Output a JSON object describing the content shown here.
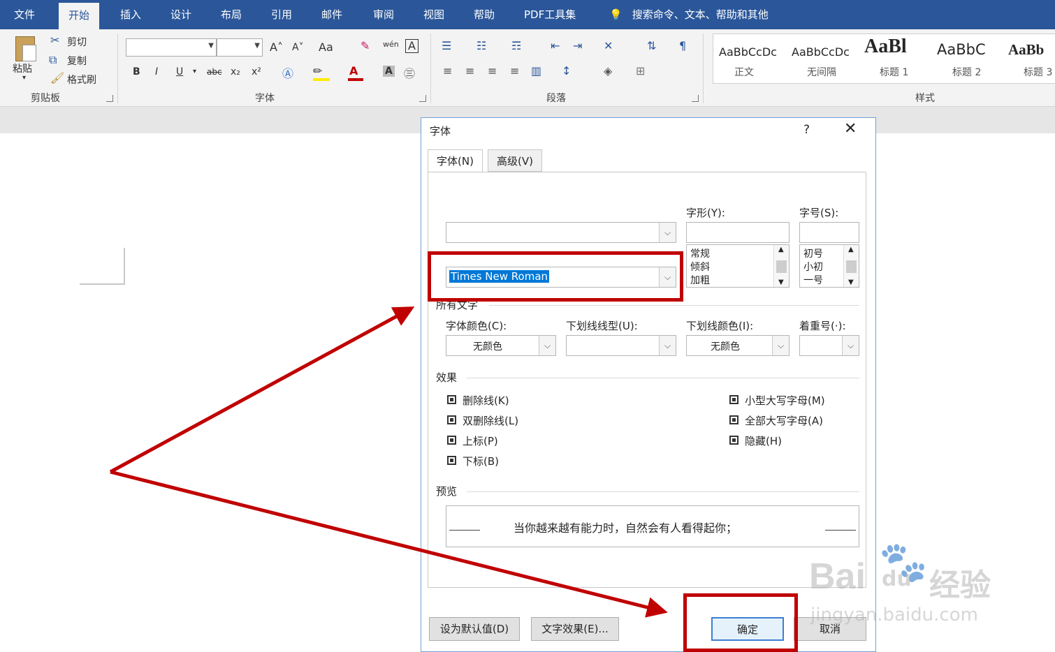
{
  "ribbon": {
    "tabs": [
      {
        "label": "文件",
        "x": 0
      },
      {
        "label": "开始",
        "x": 0
      },
      {
        "label": "插入",
        "x": 0
      },
      {
        "label": "设计",
        "x": 0
      },
      {
        "label": "布局",
        "x": 0
      },
      {
        "label": "引用",
        "x": 0
      },
      {
        "label": "邮件",
        "x": 0
      },
      {
        "label": "审阅",
        "x": 0
      },
      {
        "label": "视图",
        "x": 0
      },
      {
        "label": "帮助",
        "x": 0
      },
      {
        "label": "PDF工具集",
        "x": 0
      }
    ],
    "search_placeholder": "搜索命令、文本、帮助和其他",
    "clipboard": {
      "paste": "粘贴",
      "cut": "剪切",
      "copy": "复制",
      "format_painter": "格式刷",
      "group_label": "剪贴板"
    },
    "font_group": {
      "group_label": "字体",
      "bold": "B",
      "italic": "I",
      "underline": "U",
      "strike": "abc",
      "sub": "x₂",
      "sup": "x²",
      "grow": "A˄",
      "shrink": "A˅",
      "case": "Aa",
      "phonetic": "wén",
      "border_char": "A",
      "shading_char": "A"
    },
    "paragraph_group": {
      "group_label": "段落"
    },
    "styles_group": {
      "group_label": "样式",
      "items": [
        {
          "preview": "AaBbCcDc",
          "name": "正文"
        },
        {
          "preview": "AaBbCcDc",
          "name": "无间隔"
        },
        {
          "preview": "AaBl",
          "name": "标题 1"
        },
        {
          "preview": "AaBbC",
          "name": "标题 2"
        },
        {
          "preview": "AaBb",
          "name": "标题 3"
        }
      ]
    }
  },
  "dialog": {
    "title": "字体",
    "help": "?",
    "close": "✕",
    "tabs": [
      {
        "label": "字体(N)",
        "active": true
      },
      {
        "label": "高级(V)",
        "active": false
      }
    ],
    "style_label": "字形(Y):",
    "size_label": "字号(S):",
    "chinese_font_value": "",
    "western_font_value": "Times New Roman",
    "style_input_value": "",
    "size_input_value": "",
    "style_list": [
      "常规",
      "倾斜",
      "加粗"
    ],
    "size_list": [
      "初号",
      "小初",
      "一号"
    ],
    "all_text_heading": "所有文字",
    "font_color_label": "字体颜色(C):",
    "font_color_value": "无颜色",
    "underline_type_label": "下划线线型(U):",
    "underline_type_value": "",
    "underline_color_label": "下划线颜色(I):",
    "underline_color_value": "无颜色",
    "emphasis_label": "着重号(·):",
    "emphasis_value": "",
    "effects_heading": "效果",
    "effects_left": [
      "删除线(K)",
      "双删除线(L)",
      "上标(P)",
      "下标(B)"
    ],
    "effects_right": [
      "小型大写字母(M)",
      "全部大写字母(A)",
      "隐藏(H)"
    ],
    "preview_heading": "预览",
    "preview_text": "当你越来越有能力时，自然会有人看得起你；",
    "set_default": "设为默认值(D)",
    "text_effects": "文字效果(E)...",
    "ok": "确定",
    "cancel": "取消"
  },
  "watermark": {
    "brand": "Bai",
    "brand2": "du",
    "brand3": "经验",
    "url": "jingyan.baidu.com"
  },
  "colors": {
    "ribbon_blue": "#2b579a",
    "annotation_red": "#c00000"
  }
}
